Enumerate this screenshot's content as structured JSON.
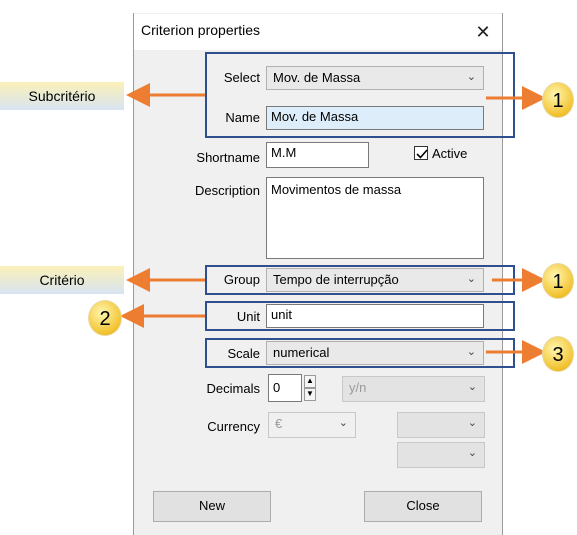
{
  "dialog": {
    "title": "Criterion properties",
    "close_glyph": "✕",
    "select_label": "Select",
    "select_value": "Mov. de  Massa",
    "name_label": "Name",
    "name_value": "Mov. de  Massa",
    "shortname_label": "Shortname",
    "shortname_value": "M.M",
    "active_label": "Active",
    "active_checked": true,
    "description_label": "Description",
    "description_value": "Movimentos de massa",
    "group_label": "Group",
    "group_value": "Tempo de interrupção",
    "unit_label": "Unit",
    "unit_value": "unit",
    "scale_label": "Scale",
    "scale_value": "numerical",
    "decimals_label": "Decimals",
    "decimals_value": "0",
    "yn_value": "y/n",
    "currency_label": "Currency",
    "currency_value": "€",
    "new_button": "New",
    "close_button": "Close"
  },
  "annotations": {
    "subcriterio": "Subcritério",
    "criterio": "Critério",
    "marker_1a": "1",
    "marker_1b": "1",
    "marker_2": "2",
    "marker_3": "3"
  },
  "colors": {
    "annotation_box": "#2f4f8f",
    "arrow": "#ed7d31",
    "marker": "#f2c230"
  },
  "icons": [
    "close-icon",
    "chevron-down-icon",
    "spin-up-icon",
    "spin-down-icon",
    "checkbox-check-icon"
  ]
}
